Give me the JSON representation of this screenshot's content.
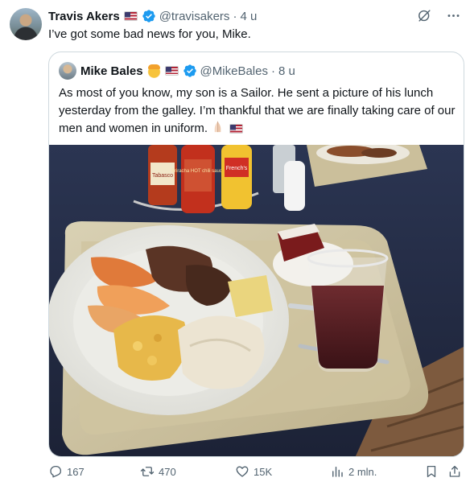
{
  "tweet": {
    "author_name": "Travis Akers",
    "author_handle": "@travisakers",
    "separator": "·",
    "time": "4 u",
    "text": "I’ve got some bad news for you, Mike."
  },
  "quoted": {
    "author_name": "Mike Bales",
    "author_handle": "@MikeBales",
    "separator": "·",
    "time": "8 u",
    "text": "As most of you know, my son is a Sailor. He sent a picture of his lunch yesterday from the galley. I’m thankful that we are finally taking care of our men and women in uniform."
  },
  "photo": {
    "bottle_labels": [
      "Tabasco",
      "Sriracha HOT chili sauce",
      "French's"
    ]
  },
  "actions": {
    "replies": "167",
    "reposts": "470",
    "likes": "15K",
    "views": "2 mln."
  },
  "colors": {
    "verified": "#1d9bf0",
    "text_secondary": "#536471",
    "border": "#cfd9de"
  },
  "icons": [
    "grok-icon",
    "more-icon",
    "verified-icon",
    "flag-us-icon",
    "reply-icon",
    "repost-icon",
    "like-icon",
    "views-icon",
    "bookmark-icon",
    "share-icon"
  ]
}
